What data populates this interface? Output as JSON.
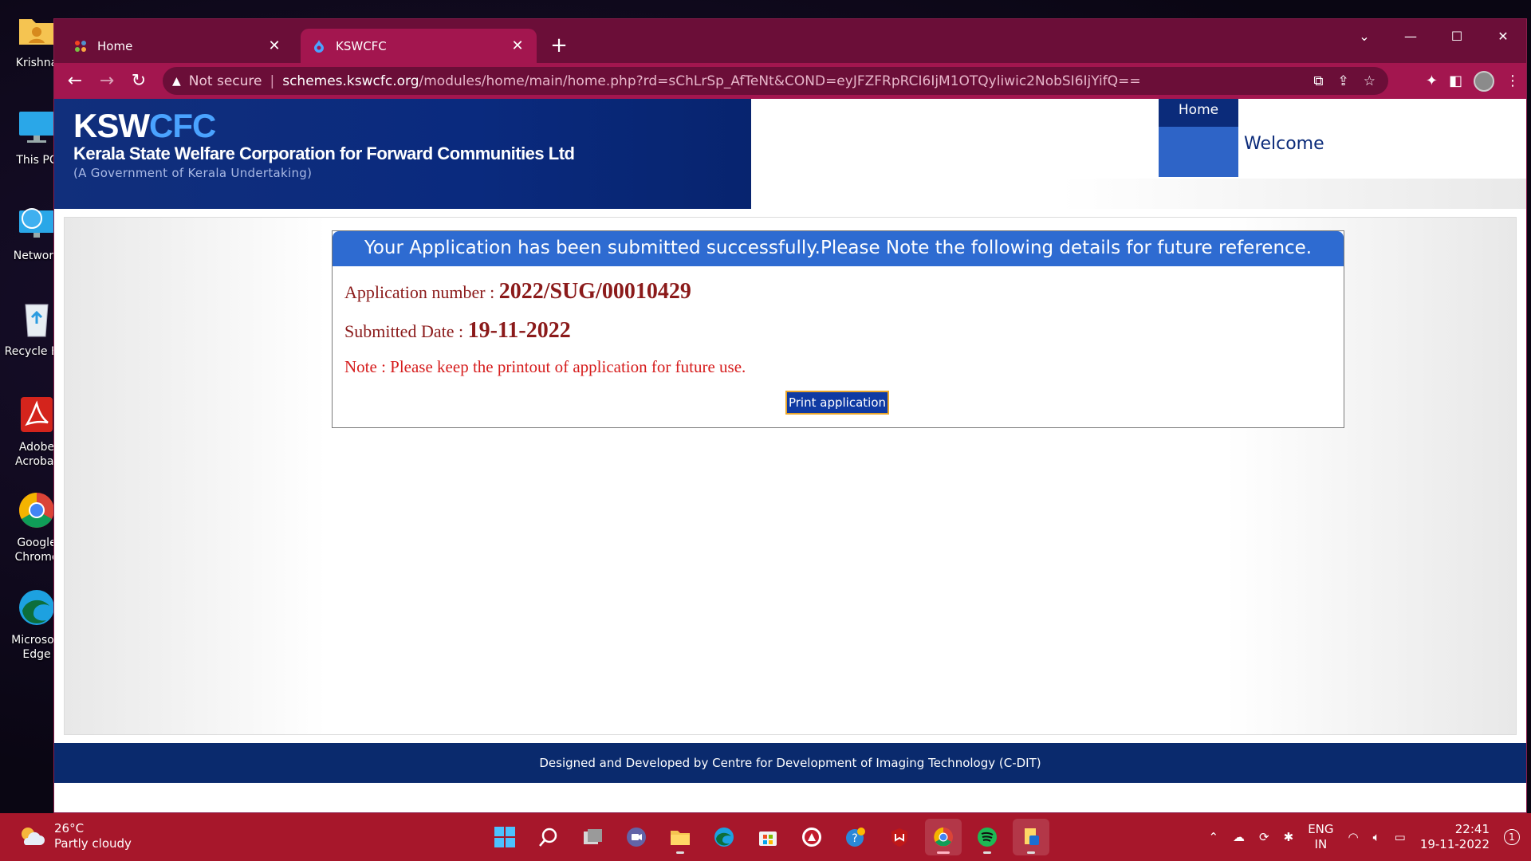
{
  "desktop": {
    "icons": [
      {
        "label": "Krishna",
        "icon": "user-folder-icon"
      },
      {
        "label": "This PC",
        "icon": "monitor-icon"
      },
      {
        "label": "Network",
        "icon": "network-icon"
      },
      {
        "label": "Recycle Bin",
        "icon": "recycle-bin-icon"
      },
      {
        "label": "Adobe Acrobat",
        "icon": "acrobat-icon"
      },
      {
        "label": "Google Chrome",
        "icon": "chrome-icon"
      },
      {
        "label": "Microsoft Edge",
        "icon": "edge-icon"
      }
    ]
  },
  "browser": {
    "tabs": [
      {
        "title": "Home",
        "active": false
      },
      {
        "title": "KSWCFC",
        "active": true
      }
    ],
    "address": {
      "security": "Not secure",
      "host": "schemes.kswcfc.org",
      "path": "/modules/home/main/home.php?rd=sChLrSp_AfTeNt&COND=eyJFZFRpRCI6IjM1OTQyliwic2NobSI6IjYifQ=="
    }
  },
  "site": {
    "logo_a": "KSW",
    "logo_b": "CFC",
    "org_name": "Kerala State Welfare Corporation for Forward Communities Ltd",
    "gov_note": "(A Government of Kerala Undertaking)",
    "nav_home": "Home",
    "welcome": "Welcome",
    "footer": "Designed and Developed by Centre for Development of Imaging Technology (C-DIT)"
  },
  "confirmation": {
    "header": "Your Application has been submitted successfully.Please Note the following details for future reference.",
    "app_number_label": "Application number : ",
    "app_number": "2022/SUG/00010429",
    "date_label": "Submitted Date : ",
    "date": "19-11-2022",
    "note": "Note : Please keep the printout of application for future use.",
    "print_button": "Print application"
  },
  "taskbar": {
    "weather_temp": "26°C",
    "weather_desc": "Partly cloudy",
    "lang_top": "ENG",
    "lang_bottom": "IN",
    "time": "22:41",
    "date": "19-11-2022",
    "notifications": "1"
  },
  "colors": {
    "tab_strip": "#6b0e38",
    "toolbar": "#a3164f",
    "banner": "#0a2a7e",
    "box_header": "#2e6bd1",
    "value_text": "#8b1a1a",
    "note_text": "#d61d1d",
    "taskbar": "#a7172b"
  }
}
